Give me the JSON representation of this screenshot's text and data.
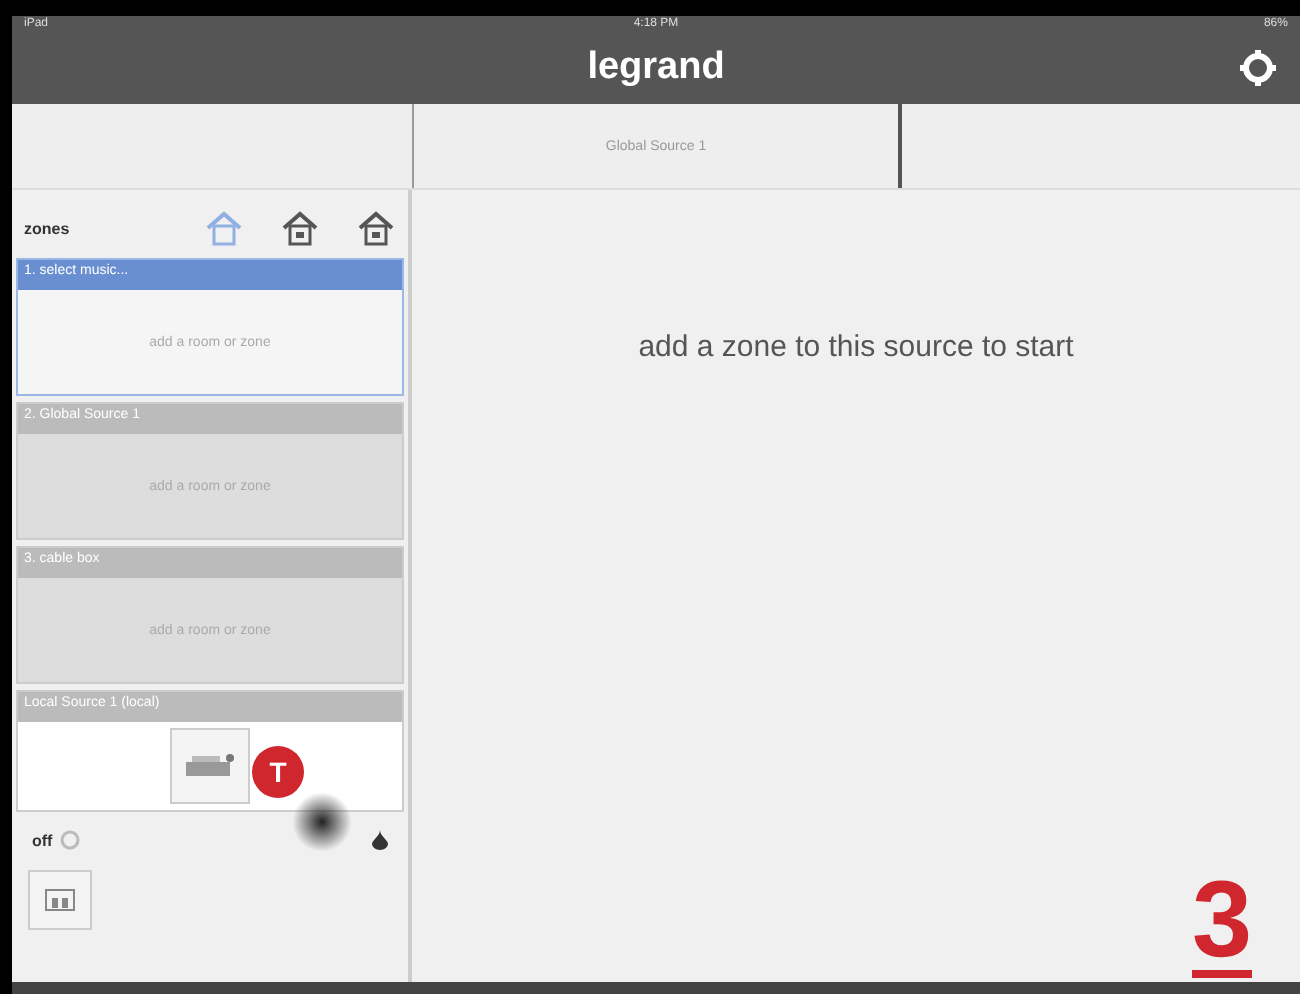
{
  "status_bar": {
    "carrier": "iPad",
    "time": "4:18 PM",
    "battery": "86%"
  },
  "header": {
    "title": "legrand"
  },
  "source_bar": {
    "source": "Global Source 1"
  },
  "zones": {
    "title": "zones",
    "filters": [
      {
        "selected": true
      },
      {
        "selected": false
      },
      {
        "selected": false
      }
    ],
    "items": [
      {
        "kind": "empty",
        "title": "1. select music...",
        "selected": true,
        "hint": "add a room or zone"
      },
      {
        "kind": "empty",
        "title": "2. Global Source 1",
        "selected": false,
        "hint": "add a room or zone"
      },
      {
        "kind": "empty",
        "title": "3. cable box",
        "selected": false,
        "hint": "add a room or zone"
      },
      {
        "kind": "rooms",
        "title": "Local Source 1 (local)",
        "selected": false,
        "rooms": [
          {
            "kind": "device"
          }
        ]
      }
    ],
    "power": {
      "label": "off",
      "on": false
    },
    "room_tiles": [
      {
        "kind": "room"
      }
    ]
  },
  "main": {
    "message": "add a zone to this source to start"
  },
  "annotations": {
    "badge": "T",
    "step": "3"
  }
}
